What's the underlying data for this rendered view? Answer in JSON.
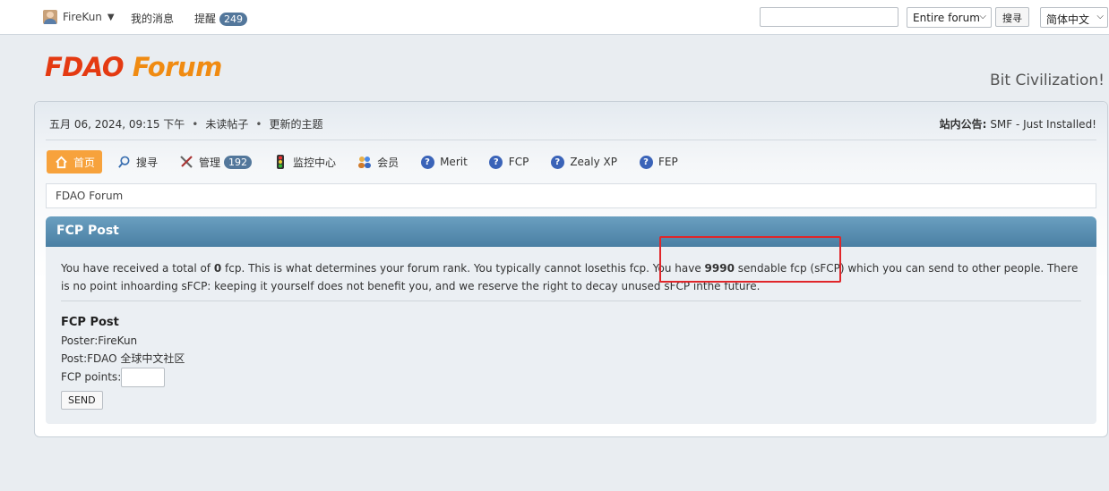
{
  "topbar": {
    "username": "FireKun",
    "dropdown_arrow": "▼",
    "my_messages": "我的消息",
    "alerts_label": "提醒",
    "alerts_count": "249",
    "search_placeholder": "",
    "search_scope": "Entire forum",
    "search_button": "搜寻",
    "language": "简体中文"
  },
  "header": {
    "logo_part1": "FDAO",
    "logo_part2": "Forum",
    "slogan": "Bit Civilization!"
  },
  "info": {
    "datetime": "五月 06, 2024, 09:15 下午",
    "unread_posts": "未读帖子",
    "updated_topics": "更新的主题",
    "news_label": "站内公告:",
    "news_text": "SMF - Just Installed!"
  },
  "menu": {
    "home": "首页",
    "search": "搜寻",
    "admin": "管理",
    "admin_count": "192",
    "moderation": "监控中心",
    "members": "会员",
    "merit": "Merit",
    "fcp": "FCP",
    "zealy": "Zealy XP",
    "fep": "FEP"
  },
  "breadcrumb": "FDAO Forum",
  "section_title": "FCP Post",
  "message": {
    "p1": "You have received a total of ",
    "total": "0",
    "p2": " fcp. This is what determines your forum rank. You typically cannot losethis fcp. You have ",
    "sendable": "9990",
    "p3": " sendable fcp (sFCP) which you can send to other people. There is no point inhoarding sFCP: keeping it yourself does not benefit you, and we reserve the right to decay unused sFCP inthe future."
  },
  "form": {
    "title": "FCP Post",
    "poster": "Poster:FireKun",
    "post": "Post:FDAO 全球中文社区",
    "points_label": "FCP points:",
    "points_value": "",
    "send": "SEND"
  },
  "colors": {
    "accent": "#f7a23c",
    "highlight": "#e0262a",
    "cat_bar": "#5a8db0"
  }
}
